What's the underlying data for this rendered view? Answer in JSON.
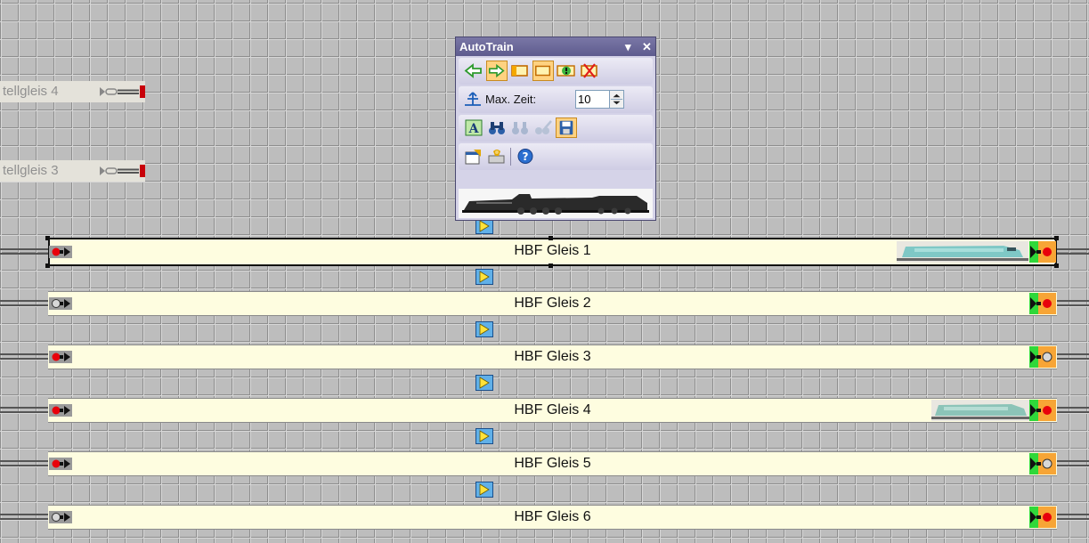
{
  "sidings": [
    {
      "label": "tellgleis 4"
    },
    {
      "label": "tellgleis 3"
    }
  ],
  "tracks": [
    {
      "label": "HBF Gleis 1",
      "selected": true,
      "left_signal": "red",
      "right_signal": "red",
      "locomotive": "teal-electric-locomotive"
    },
    {
      "label": "HBF Gleis 2",
      "selected": false,
      "left_signal": "gray",
      "right_signal": "red",
      "locomotive": ""
    },
    {
      "label": "HBF Gleis 3",
      "selected": false,
      "left_signal": "red",
      "right_signal": "gray",
      "locomotive": ""
    },
    {
      "label": "HBF Gleis 4",
      "selected": false,
      "left_signal": "red",
      "right_signal": "red",
      "locomotive": "teal-electric-locomotive"
    },
    {
      "label": "HBF Gleis 5",
      "selected": false,
      "left_signal": "red",
      "right_signal": "gray",
      "locomotive": ""
    },
    {
      "label": "HBF Gleis 6",
      "selected": false,
      "left_signal": "gray",
      "right_signal": "red",
      "locomotive": ""
    }
  ],
  "autotrain": {
    "title": "AutoTrain",
    "menu_icon": "dropdown-triangle-icon",
    "close_icon": "close-icon",
    "toolbar1": [
      "arrow-left-icon",
      "arrow-right-icon",
      "block-left-icon",
      "block-both-icon",
      "block-alert-icon",
      "block-delete-icon"
    ],
    "max_time_label": "Max. Zeit:",
    "max_time_value": "10",
    "toolbar3": [
      "text-a-icon",
      "binoculars-icon",
      "binoculars-disabled-icon",
      "binoculars-edit-disabled-icon",
      "save-icon"
    ],
    "toolbar4": [
      "properties-icon",
      "wizard-icon",
      "help-icon"
    ],
    "preview": "steam-locomotive-image"
  },
  "colors": {
    "signal_red": "#e8000b",
    "signal_green": "#2fd83a",
    "signal_bg": "#f7a536",
    "block_bg": "#fefde0",
    "active_button": "#ffd280"
  }
}
